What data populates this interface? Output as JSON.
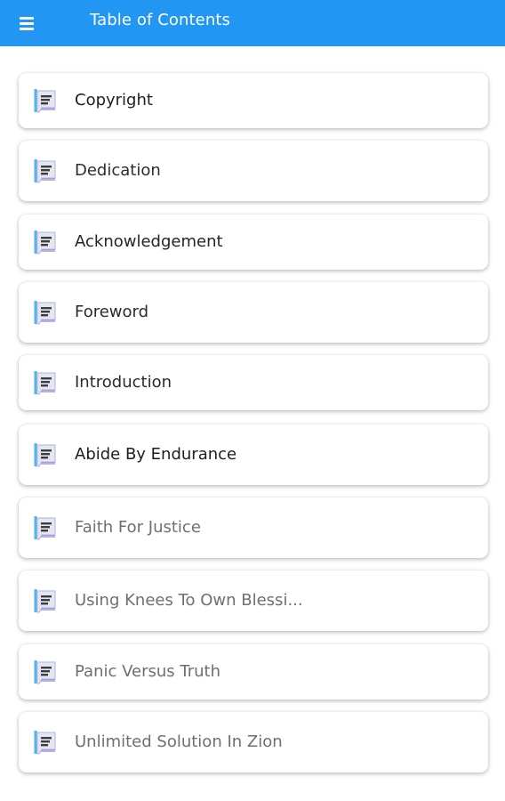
{
  "appbar": {
    "title": "Table of Contents",
    "menu_icon": "hamburger-menu-icon",
    "color": "#2196f3"
  },
  "chapters": [
    {
      "label": "Copyright",
      "icon": "chapter-book-icon",
      "text_color": "#1e1e1e"
    },
    {
      "label": "Dedication",
      "icon": "chapter-book-icon",
      "text_color": "#2d2d2d"
    },
    {
      "label": "Acknowledgement",
      "icon": "chapter-book-icon",
      "text_color": "#252525"
    },
    {
      "label": "Foreword",
      "icon": "chapter-book-icon",
      "text_color": "#2b2b2b"
    },
    {
      "label": "Introduction",
      "icon": "chapter-book-icon",
      "text_color": "#2b2b2b"
    },
    {
      "label": "Abide By Endurance",
      "icon": "chapter-book-icon",
      "text_color": "#1e1e1e"
    },
    {
      "label": "Faith For Justice",
      "icon": "chapter-book-icon",
      "text_color": "#6f6f6f"
    },
    {
      "label": "Using Knees To Own Blessi...",
      "icon": "chapter-book-icon",
      "text_color": "#6f6f6f"
    },
    {
      "label": "Panic Versus Truth",
      "icon": "chapter-book-icon",
      "text_color": "#6f6f6f"
    },
    {
      "label": "Unlimited Solution In Zion",
      "icon": "chapter-book-icon",
      "text_color": "#6f6f6f"
    }
  ]
}
